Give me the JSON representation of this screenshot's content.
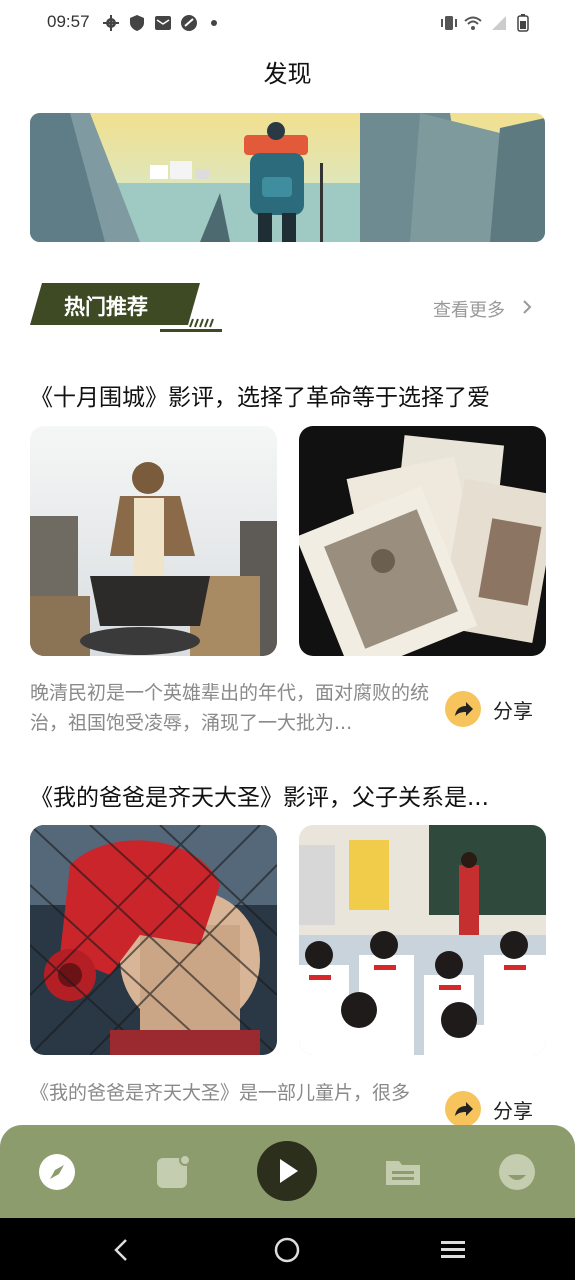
{
  "status_bar": {
    "time": "09:57",
    "icons_left": [
      "gear-icon",
      "shield-icon",
      "mail-icon",
      "vpn-icon",
      "dot-icon"
    ],
    "icons_right": [
      "vibrate-icon",
      "wifi-icon",
      "signal-icon",
      "battery-icon"
    ]
  },
  "header": {
    "title": "发现"
  },
  "hot": {
    "title": "热门推荐",
    "see_more": "查看更多"
  },
  "articles": [
    {
      "title": "《十月围城》影评，选择了革命等于选择了爱",
      "desc": "晚清民初是一个英雄辈出的年代，面对腐败的统治，祖国饱受凌辱，涌现了一大批为...",
      "share_label": "分享"
    },
    {
      "title": "《我的爸爸是齐天大圣》影评，父子关系是...",
      "desc": "《我的爸爸是齐天大圣》是一部儿童片，很多",
      "share_label": "分享"
    }
  ],
  "tabbar": {
    "items": [
      "compass-icon",
      "note-icon",
      "play-icon",
      "folder-icon",
      "profile-icon"
    ]
  },
  "colors": {
    "accent": "#8d9c6c",
    "dark": "#2b2f1c",
    "share": "#f6c35c"
  }
}
